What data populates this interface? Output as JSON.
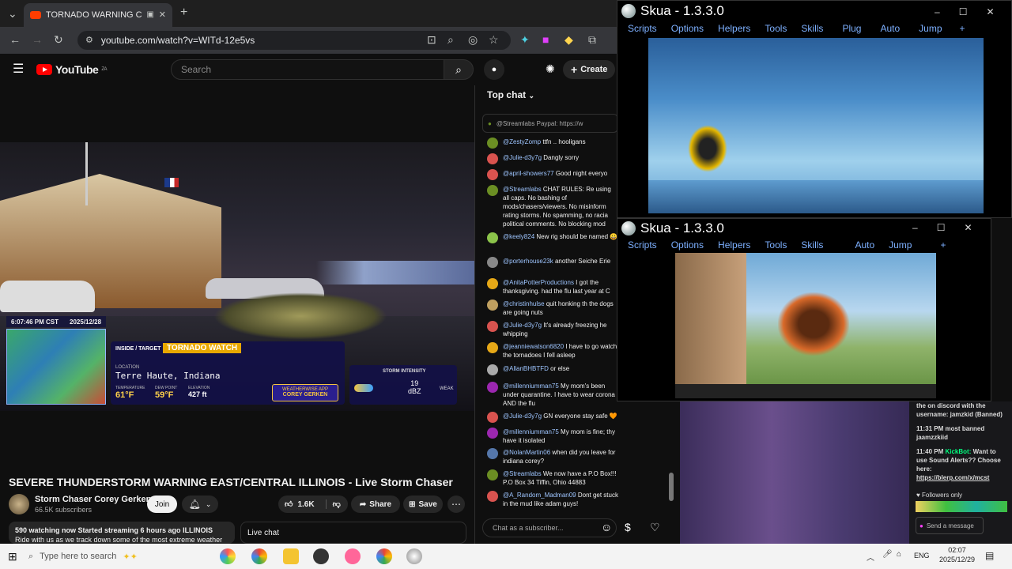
{
  "browser": {
    "tab_title": "TORNADO WARNING CENT",
    "url": "youtube.com/watch?v=WITd-12e5vs"
  },
  "youtube": {
    "logo_text": "YouTube",
    "logo_region": "ZA",
    "search_placeholder": "Search",
    "create_label": "Create",
    "video_title": "SEVERE THUNDERSTORM WARNING EAST/CENTRAL ILLINOIS - Live Storm Chaser",
    "channel_name": "Storm Chaser Corey Gerken",
    "subscribers": "66.5K subscribers",
    "join_label": "Join",
    "likes": "1.6K",
    "share_label": "Share",
    "save_label": "Save",
    "description_stats": "590 watching now  Started streaming 6 hours ago",
    "description_tag": "ILLINOIS",
    "description_text": "Ride with us as we track down some of the most extreme weather",
    "live_chat_label": "Live chat"
  },
  "overlay": {
    "time": "6:07:46 PM CST",
    "date": "2025/12/28",
    "mode": "INSIDE / TARGET",
    "warning": "TORNADO WATCH",
    "location_label": "LOCATION",
    "location": "Terre Haute, Indiana",
    "temp_label": "TEMPERATURE",
    "temp": "61°F",
    "dew_label": "DEW POINT",
    "dew": "59°F",
    "elev_label": "ELEVATION",
    "elev": "427 ft",
    "badge_top": "WEATHERWISE APP",
    "badge_name": "COREY GERKEN",
    "storm_label": "STORM INTENSITY",
    "storm_value": "19",
    "storm_unit": "dBZ",
    "storm_level": "WEAK"
  },
  "chat": {
    "header": "Top chat",
    "pinned": "@Streamlabs  Paypal: https://w",
    "input_placeholder": "Chat as a subscriber...",
    "messages": [
      {
        "author": "@ZestyZomp",
        "text": "ttfn .. hooligans",
        "color": "#6b8e23"
      },
      {
        "author": "@Julie-d3y7g",
        "text": "Dangly sorry",
        "color": "#d9534f"
      },
      {
        "author": "@april-showers77",
        "text": "Good night everyo",
        "color": "#d9534f"
      },
      {
        "author": "@Streamlabs",
        "text": "CHAT RULES: Re using all caps. No bashing of mods/chasers/viewers. No misinform rating storms. No spamming, no racia political comments. No blocking mod",
        "color": "#6b8e23"
      },
      {
        "author": "@keely824",
        "text": "New rig should be named 😀",
        "color": "#8bc34a"
      },
      {
        "author": "@porterhouse23k",
        "text": "another Seiche Erie",
        "color": "#888888"
      },
      {
        "author": "@AnitaPotterProductions",
        "text": "I got the thanksgiving. had the flu last year at C",
        "color": "#e6a817"
      },
      {
        "author": "@christinhulse",
        "text": "quit honking th the dogs are going nuts",
        "color": "#c0a060"
      },
      {
        "author": "@Julie-d3y7g",
        "text": "It's already freezing he whipping",
        "color": "#d9534f"
      },
      {
        "author": "@jeanniewatson6820",
        "text": "I have to go watch the tornadoes I fell asleep",
        "color": "#e6a817"
      },
      {
        "author": "@AllanBHBTFD",
        "text": "or else",
        "color": "#aaaaaa"
      },
      {
        "author": "@millenniumman75",
        "text": "My mom's been under quarantine. I have to wear corona AND the flu",
        "color": "#9c27b0"
      },
      {
        "author": "@Julie-d3y7g",
        "text": "GN everyone stay safe 🧡",
        "color": "#d9534f"
      },
      {
        "author": "@millenniumman75",
        "text": "My mom is fine; thy have it isolated",
        "color": "#9c27b0"
      },
      {
        "author": "@NolanMartin06",
        "text": "when did you leave for indiana corey?",
        "color": "#5577aa"
      },
      {
        "author": "@Streamlabs",
        "text": "We now have a P.O Box!!! P.O Box 34 Tiffin, Ohio 44883",
        "color": "#6b8e23"
      },
      {
        "author": "@A_Random_Madman09",
        "text": "Dont get stuck in the mud like adam guys!",
        "color": "#d9534f"
      }
    ]
  },
  "skua": {
    "title": "Skua - 1.3.3.0",
    "menu1": [
      "Scripts",
      "Options",
      "Helpers",
      "Tools",
      "Skills",
      "Plug",
      "Auto",
      "Jump",
      "+"
    ],
    "menu2": [
      "Scripts",
      "Options",
      "Helpers",
      "Tools",
      "Skills",
      "Auto",
      "Jump",
      "+"
    ]
  },
  "side_chat": {
    "line1": "the on discord with the username: jamzkid (Banned)",
    "line2_time": "11:31 PM",
    "line2": "most banned jaamzzkiid",
    "line3_time": "11:40 PM",
    "line3_user": "KickBot:",
    "line3": "Want to use Sound Alerts?? Choose here:",
    "line3_link": "https://blerp.com/x/mcst",
    "followers": "Followers only",
    "send_label": "Send a message"
  },
  "taskbar": {
    "search_placeholder": "Type here to search",
    "lang": "ENG",
    "time": "02:07",
    "date": "2025/12/29"
  },
  "colors": {
    "youtube_red": "#ff0000",
    "skua_menu": "#7db0ff",
    "warning_yellow": "#e8a800"
  }
}
